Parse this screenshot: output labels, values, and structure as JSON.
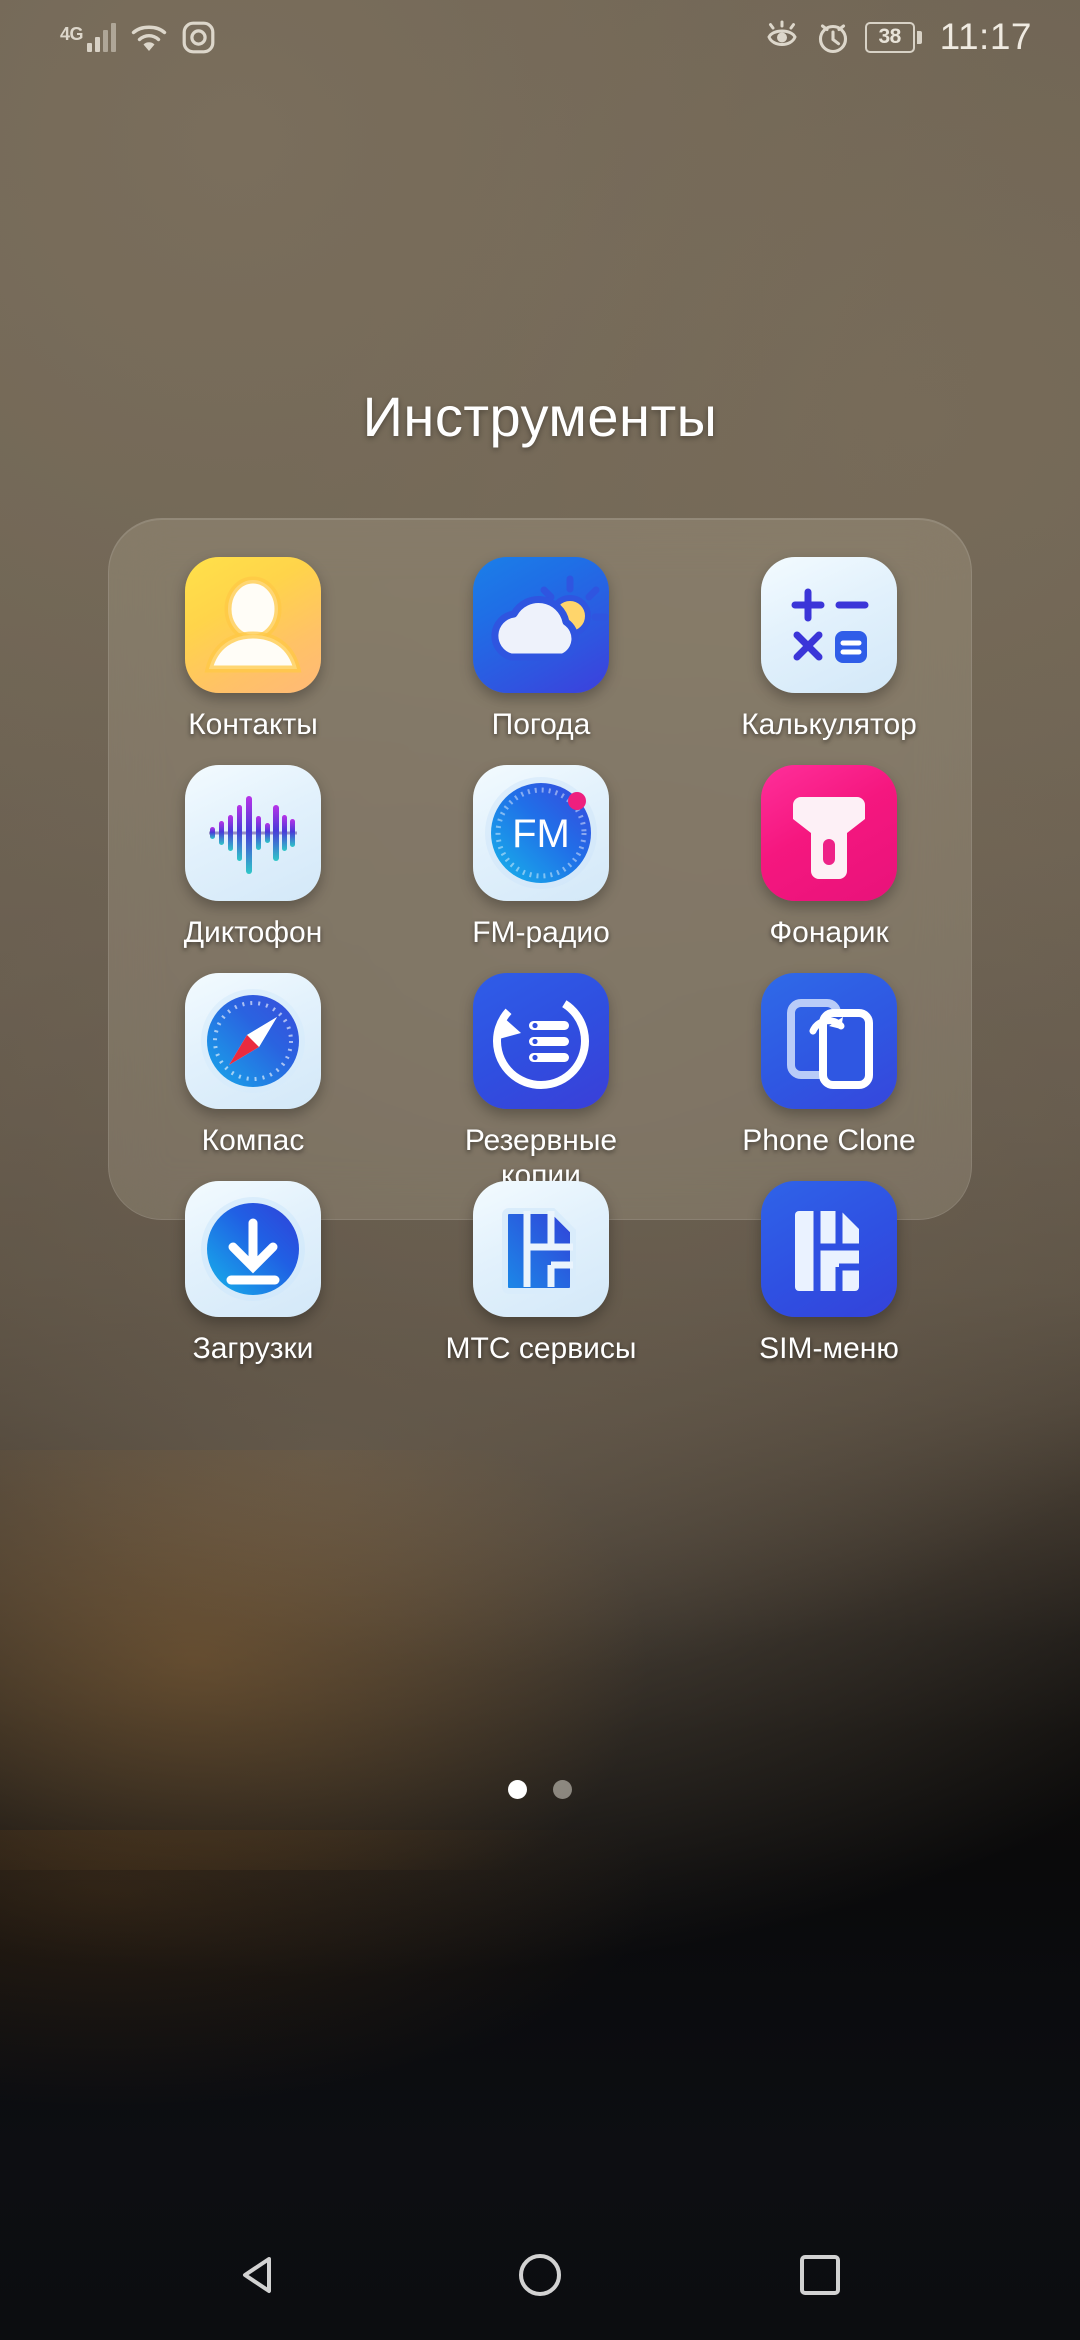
{
  "status_bar": {
    "network_type": "4G",
    "icons_left": [
      "signal-icon",
      "wifi-icon",
      "instagram-icon"
    ],
    "icons_right": [
      "eye-comfort-icon",
      "alarm-icon"
    ],
    "battery_level": "38",
    "time": "11:17"
  },
  "folder": {
    "title": "Инструменты",
    "apps": [
      {
        "label": "Контакты",
        "icon": "contacts-icon"
      },
      {
        "label": "Погода",
        "icon": "weather-icon"
      },
      {
        "label": "Калькулятор",
        "icon": "calculator-icon"
      },
      {
        "label": "Диктофон",
        "icon": "recorder-icon"
      },
      {
        "label": "FM-радио",
        "icon": "fm-radio-icon"
      },
      {
        "label": "Фонарик",
        "icon": "flashlight-icon"
      },
      {
        "label": "Компас",
        "icon": "compass-icon"
      },
      {
        "label": "Резервные копии",
        "icon": "backup-icon"
      },
      {
        "label": "Phone Clone",
        "icon": "phone-clone-icon"
      },
      {
        "label": "Загрузки",
        "icon": "downloads-icon"
      },
      {
        "label": "МТС сервисы",
        "icon": "mts-services-icon"
      },
      {
        "label": "SIM-меню",
        "icon": "sim-menu-icon"
      }
    ],
    "page_count": 2,
    "current_page": 1
  },
  "fm_radio": {
    "dial_label": "FM"
  },
  "nav_bar": {
    "buttons": [
      {
        "name": "back-button",
        "icon": "triangle-left-icon"
      },
      {
        "name": "home-button",
        "icon": "circle-icon"
      },
      {
        "name": "recents-button",
        "icon": "square-icon"
      }
    ]
  },
  "colors": {
    "accent_blue": "#2f5de8",
    "accent_pink": "#f5177f",
    "accent_yellow": "#ffd44a",
    "text_white": "#ffffff"
  }
}
